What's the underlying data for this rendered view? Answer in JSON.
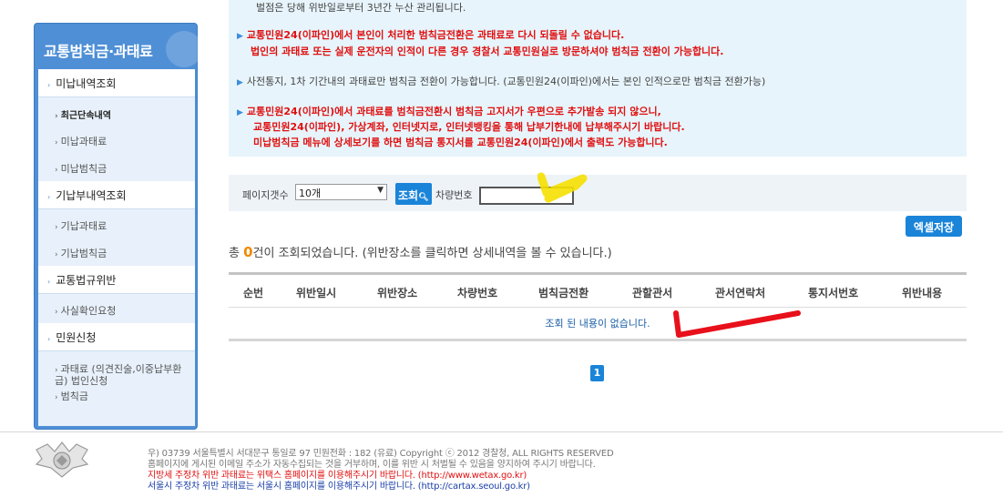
{
  "sidebar": {
    "title": "교통범칙금·과태료",
    "menus": [
      {
        "label": "미납내역조회",
        "subs": [
          "최근단속내역",
          "미납과태료",
          "미납범칙금"
        ]
      },
      {
        "label": "기납부내역조회",
        "subs": [
          "기납과태료",
          "기납범칙금"
        ]
      },
      {
        "label": "교통법규위반",
        "subs": [
          "사실확인요청"
        ]
      },
      {
        "label": "민원신청",
        "subs": [
          "과태료 (의견진술,이중납부환",
          "급) 법인신청",
          "범칙금"
        ]
      }
    ]
  },
  "notice": {
    "line0": "벌점은 당해 위반일로부터 3년간 누산 관리됩니다.",
    "line1": "교통민원24(이파인)에서 본인이 처리한 범칙금전환은 과태료로 다시 되돌릴 수 없습니다.",
    "line2": "법인의 과태료 또는 실제 운전자의 인적이 다른 경우 경찰서 교통민원실로 방문하셔야 범칙금 전환이 가능합니다.",
    "line3": "사전통지, 1차 기간내의 과태료만 범칙금 전환이 가능합니다. (교통민원24(이파인)에서는 본인 인적으로만 범칙금 전환가능)",
    "line4": "교통민원24(이파인)에서 과태료를 범칙금전환시 범칙금 고지서가 우편으로 추가발송 되지 않으니,",
    "line5": "교통민원24(이파인), 가상계좌, 인터넷지로, 인터넷뱅킹을 통해 납부기한내에 납부해주시기 바랍니다.",
    "line6": "미납범칙금 메뉴에 상세보기를 하면 범칙금 통지서를 교통민원24(이파인)에서 출력도 가능합니다."
  },
  "search": {
    "page_count_label": "페이지갯수",
    "page_count_value": "10개",
    "search_button": "조회",
    "plate_label": "차량번호",
    "plate_value": ""
  },
  "excel_button": "엑셀저장",
  "result": {
    "prefix": "총 ",
    "count": "0",
    "suffix": "건이 조회되었습니다. (위반장소를 클릭하면 상세내역을 볼 수 있습니다.)"
  },
  "table": {
    "headers": [
      "순번",
      "위반일시",
      "위반장소",
      "차량번호",
      "범칙금전환",
      "관할관서",
      "관서연락처",
      "통지서번호",
      "위반내용"
    ],
    "empty_message": "조회 된 내용이 없습니다."
  },
  "pagination": {
    "current": "1"
  },
  "footer": {
    "address": "우) 03739 서울특별시 서대문구 통일로 97   민원전화 : 182 (유료)        Copyright ⓒ 2012 경찰청, ALL RIGHTS RESERVED",
    "notice": "홈페이지에 게시된 이메일 주소가 자동수집되는 것을 거부하며, 이를 위반 시 처벌될 수 있음을 양지하여 주시기 바랍니다.",
    "red_line": "지방세 주정차 위반 과태료는 위택스 홈페이지를 이용해주시기 바랍니다. (http://www.wetax.go.kr)",
    "blue_line": "서울시 주정차 위반 과태료는 서울시 홈페이지를 이용해주시기 바랍니다. (http://cartax.seoul.go.kr)"
  },
  "colors": {
    "accent": "#1a84d8",
    "sidebar": "#4f8fd6",
    "warning": "#e01010",
    "count": "#f08a00"
  }
}
